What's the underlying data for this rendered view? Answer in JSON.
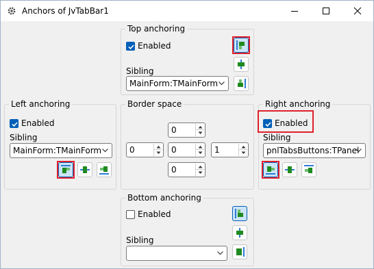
{
  "window": {
    "title": "Anchors of JvTabBar1",
    "icons": {
      "app": "gear-icon",
      "minimize": "minimize-icon",
      "maximize": "maximize-icon",
      "close": "close-icon"
    }
  },
  "top": {
    "title": "Top anchoring",
    "enabled_label": "Enabled",
    "enabled": true,
    "sibling_label": "Sibling",
    "sibling_value": "MainForm:TMainForm"
  },
  "left": {
    "title": "Left anchoring",
    "enabled_label": "Enabled",
    "enabled": true,
    "sibling_label": "Sibling",
    "sibling_value": "MainForm:TMainForm"
  },
  "border": {
    "title": "Border space",
    "top": "0",
    "left": "0",
    "center": "0",
    "right": "1",
    "bottom": "0"
  },
  "right": {
    "title": "Right anchoring",
    "enabled_label": "Enabled",
    "enabled": true,
    "sibling_label": "Sibling",
    "sibling_value": "pnlTabsButtons:TPanel"
  },
  "bottom": {
    "title": "Bottom anchoring",
    "enabled_label": "Enabled",
    "enabled": false,
    "sibling_label": "Sibling",
    "sibling_value": ""
  },
  "colors": {
    "accent": "#005fb8",
    "highlight": "#e0202a",
    "anchor_green": "#1f8a1f",
    "anchor_blue": "#2b7bd6"
  }
}
